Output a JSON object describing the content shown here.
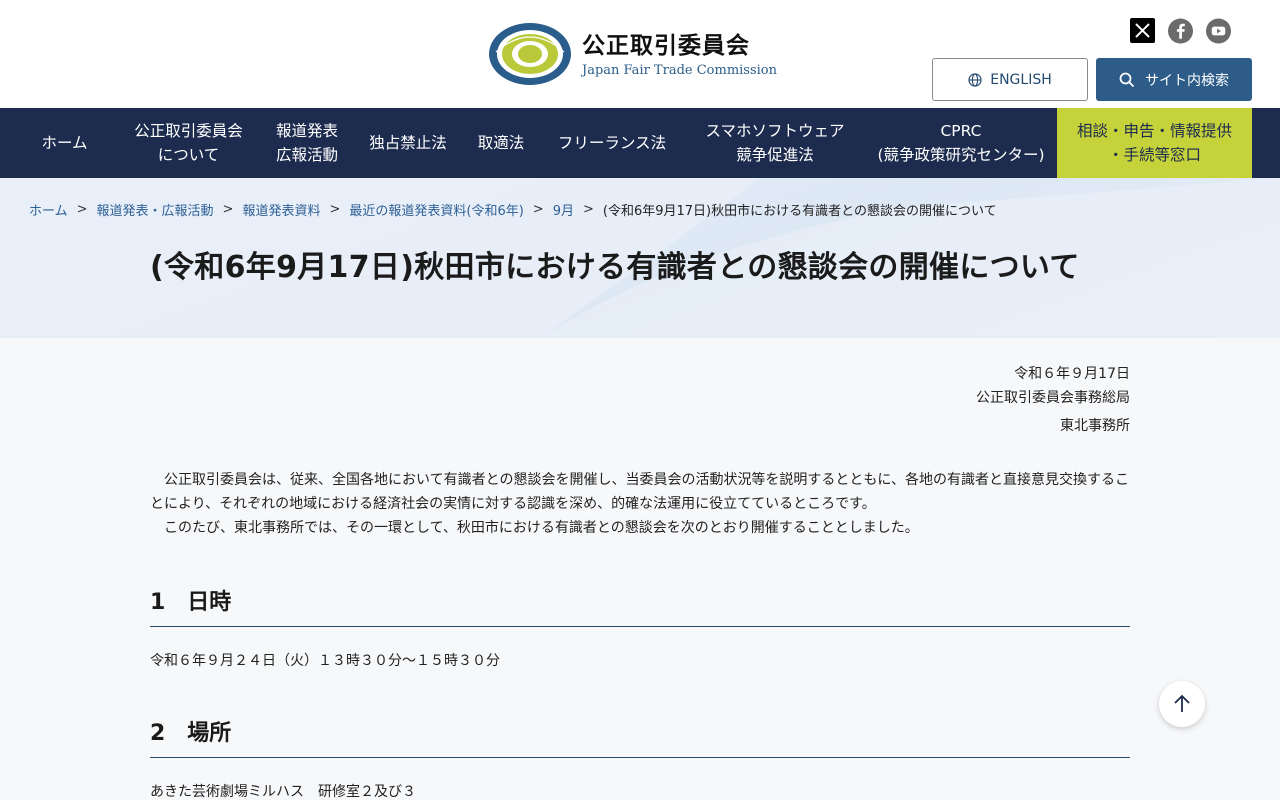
{
  "header": {
    "org_name": "公正取引委員会",
    "org_name_en": "Japan Fair Trade Commission",
    "logo_ring_text": "JAPAN FAIR TRADE COMMISSION",
    "english_label": "ENGLISH",
    "search_label": "サイト内検索",
    "social": [
      "x-icon",
      "facebook-icon",
      "youtube-icon"
    ]
  },
  "nav": {
    "items": [
      {
        "label": "ホーム",
        "width": 0
      },
      {
        "label": "公正取引委員会\nについて"
      },
      {
        "label": "報道発表\n広報活動"
      },
      {
        "label": "独占禁止法"
      },
      {
        "label": "取適法"
      },
      {
        "label": "フリーランス法"
      },
      {
        "label": "スマホソフトウェア\n競争促進法"
      },
      {
        "label": "CPRC\n(競争政策研究センター)"
      },
      {
        "label": "相談・申告・情報提供\n・手続等窓口"
      }
    ]
  },
  "breadcrumb": {
    "items": [
      "ホーム",
      "報道発表・広報活動",
      "報道発表資料",
      "最近の報道発表資料(令和6年)",
      "9月"
    ],
    "current": "(令和6年9月17日)秋田市における有識者との懇談会の開催について"
  },
  "page": {
    "title": "(令和6年9月17日)秋田市における有識者との懇談会の開催について",
    "date": "令和６年９月17日",
    "issuer1": "公正取引委員会事務総局",
    "issuer2": "東北事務所",
    "para1": "公正取引委員会は、従来、全国各地において有識者との懇談会を開催し、当委員会の活動状況等を説明するとともに、各地の有識者と直接意見交換することにより、それぞれの地域における経済社会の実情に対する認識を深め、的確な法運用に役立てているところです。",
    "para2": "このたび、東北事務所では、その一環として、秋田市における有識者との懇談会を次のとおり開催することとしました。",
    "sections": [
      {
        "heading": "1　日時",
        "text": "令和６年９月２４日（火）１３時３０分～１５時３０分"
      },
      {
        "heading": "2　場所",
        "text": "あきた芸術劇場ミルハス　研修室２及び３"
      }
    ]
  },
  "colors": {
    "nav_bg": "#1c2b4e",
    "help_bg": "#c6d23a",
    "search_btn": "#2d5c88",
    "link": "#2e5f96"
  }
}
